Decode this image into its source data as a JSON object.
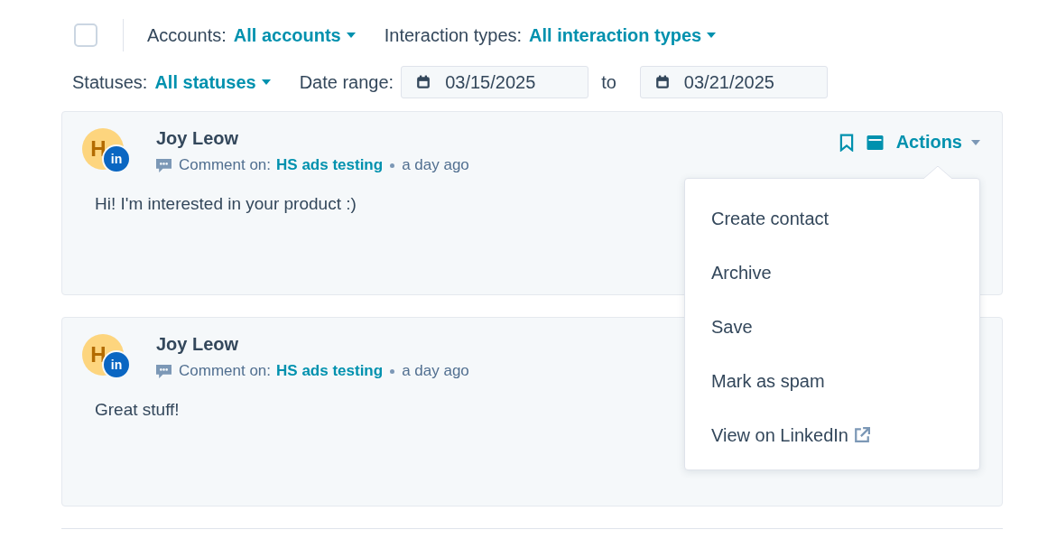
{
  "toolbar": {
    "select_all_checked": false,
    "filters": [
      {
        "label": "Accounts:",
        "value": "All accounts"
      },
      {
        "label": "Interaction types:",
        "value": "All interaction types"
      }
    ]
  },
  "second_row": {
    "status_filter": {
      "label": "Statuses:",
      "value": "All statuses"
    },
    "date_range": {
      "label": "Date range:",
      "from": "03/15/2025",
      "separator": "to",
      "to": "03/21/2025"
    }
  },
  "posts": [
    {
      "avatar_initial": "H",
      "network_badge": "in",
      "author": "Joy Leow",
      "context_label": "Comment on:",
      "context_link": "HS ads testing",
      "time": "a day ago",
      "text": "Hi! I'm interested in your product :)",
      "actions_label": "Actions"
    },
    {
      "avatar_initial": "H",
      "network_badge": "in",
      "author": "Joy Leow",
      "context_label": "Comment on:",
      "context_link": "HS ads testing",
      "time": "a day ago",
      "text": "Great stuff!"
    }
  ],
  "actions_menu": {
    "items": [
      {
        "label": "Create contact",
        "kind": "plain"
      },
      {
        "label": "Archive",
        "kind": "plain"
      },
      {
        "label": "Save",
        "kind": "plain"
      },
      {
        "label": "Mark as spam",
        "kind": "plain"
      },
      {
        "label": "View on LinkedIn",
        "kind": "external"
      }
    ]
  }
}
